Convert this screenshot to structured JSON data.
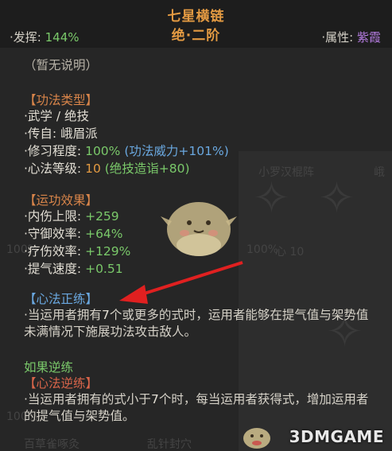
{
  "header": {
    "title_line1": "七星横链",
    "title_line2": "绝·二阶",
    "left_label": "·发挥:",
    "left_value": "144%",
    "right_label": "·属性:",
    "right_value": "紫霞"
  },
  "description": "（暂无说明）",
  "section_type": {
    "title": "【功法类型】",
    "lines": [
      {
        "label": "·武学 / 绝技",
        "value": "",
        "note": ""
      },
      {
        "label": "·传自: 峨眉派",
        "value": "",
        "note": ""
      },
      {
        "label": "·修习程度: ",
        "value": "100%",
        "note": "(功法威力+101%)"
      },
      {
        "label": "·心法等级: ",
        "value": "10",
        "note": "(绝技造诣+80)"
      }
    ]
  },
  "section_effect": {
    "title": "【运功效果】",
    "lines": [
      {
        "label": "·内伤上限: ",
        "value": "+259"
      },
      {
        "label": "·守御效率: ",
        "value": "+64%"
      },
      {
        "label": "·疗伤效率: ",
        "value": "+129%"
      },
      {
        "label": "·提气速度: ",
        "value": "+0.51"
      }
    ]
  },
  "section_positive": {
    "title": "【心法正练】",
    "text_pre": "·当运用者拥有",
    "text_num": "7",
    "text_post": "个或更多的式时，运用者能够在提气值与架势值未满情况下施展功法攻击敌人。"
  },
  "section_reverse": {
    "subtitle": "如果逆练",
    "title": "【心法逆练】",
    "text_pre": "·当运用者拥有的式小于",
    "text_num": "7",
    "text_post": "个时，每当运用者获得式，增加运用者的提气值与架势值。"
  },
  "background": {
    "ghost_labels": [
      "小罗汉棍阵",
      "峨",
      "100%",
      "心 10",
      "100%",
      "心 10",
      "100%",
      "心 10",
      "百草雀啄灸",
      "乱针封穴"
    ]
  },
  "watermark": "3DMGAME",
  "colors": {
    "accent_orange": "#e39a42",
    "section_orange": "#d9854a",
    "value_green": "#7ac96a",
    "attr_purple": "#b57ce0",
    "note_blue": "#6aa8e0",
    "arrow_red": "#e02020"
  }
}
